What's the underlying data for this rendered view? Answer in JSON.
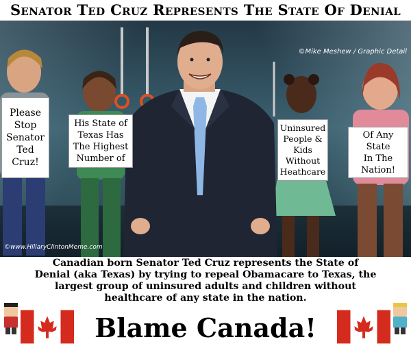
{
  "title": "Senator Ted Cruz Represents The State Of Denial",
  "credit": "©Mike Meshew / Graphic Detail",
  "site": "©www.HillaryClintonMeme.com",
  "signs": [
    {
      "text": "Please\nStop\nSenator\nTed\nCruz!"
    },
    {
      "text": "His State of\nTexas Has\nThe Highest\nNumber of"
    },
    {
      "text": "Uninsured\nPeople &\nKids\nWithout\nHeathcare"
    },
    {
      "text": "Of Any\nState\nIn The\nNation!"
    }
  ],
  "caption": {
    "line1": "Canadian born Senator Ted Cruz represents the State of",
    "line2": "Denial (aka Texas) by trying to repeal Obamacare to Texas, the",
    "line3": "largest group of uninsured adults and children without",
    "line4": "healthcare of any state in the nation."
  },
  "banner": "Blame Canada!",
  "colors": {
    "flag_red": "#d52b1e",
    "scene_bg": "#2f4c5a",
    "suit": "#1f2533"
  }
}
